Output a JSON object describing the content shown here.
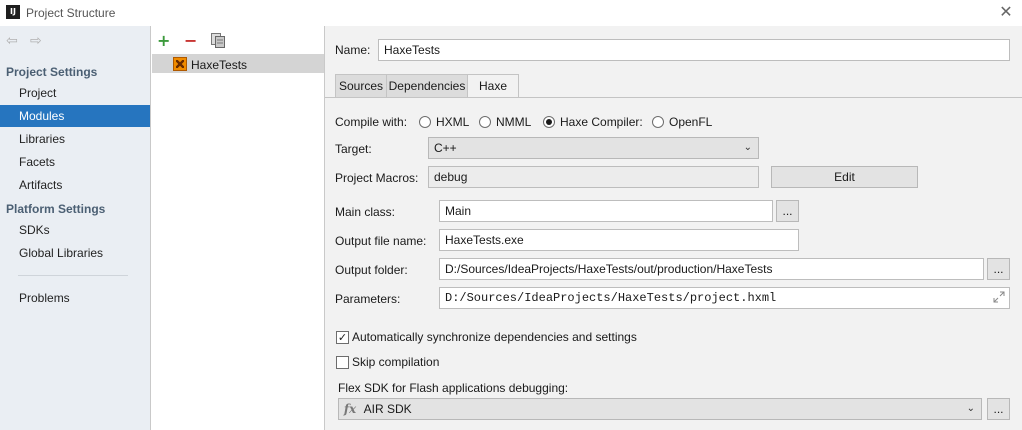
{
  "window": {
    "title": "Project Structure",
    "app_icon": "IJ"
  },
  "nav": {
    "back_icon": "arrow-left-icon",
    "forward_icon": "arrow-right-icon",
    "project_settings_header": "Project Settings",
    "project_settings_items": [
      "Project",
      "Modules",
      "Libraries",
      "Facets",
      "Artifacts"
    ],
    "selected": "Modules",
    "platform_settings_header": "Platform Settings",
    "platform_settings_items": [
      "SDKs",
      "Global Libraries"
    ],
    "problems": "Problems"
  },
  "module_list": {
    "toolbar": {
      "add": "+",
      "remove": "−"
    },
    "modules": [
      "HaxeTests"
    ]
  },
  "module_settings": {
    "name_label": "Name:",
    "name_value": "HaxeTests",
    "tabs": [
      "Sources",
      "Dependencies",
      "Haxe"
    ],
    "active_tab": "Haxe",
    "compile_with_label": "Compile with:",
    "compile_options": [
      "HXML",
      "NMML",
      "Haxe Compiler:",
      "OpenFL"
    ],
    "compile_selected": "Haxe Compiler:",
    "target_label": "Target:",
    "target_value": "C++",
    "macros_label": "Project Macros:",
    "macros_value": "debug",
    "edit_button": "Edit",
    "main_class_label": "Main class:",
    "main_class_value": "Main",
    "browse_label": "...",
    "output_file_label": "Output file name:",
    "output_file_value": "HaxeTests.exe",
    "output_folder_label": "Output folder:",
    "output_folder_value": "D:/Sources/IdeaProjects/HaxeTests/out/production/HaxeTests",
    "parameters_label": "Parameters:",
    "parameters_value": "D:/Sources/IdeaProjects/HaxeTests/project.hxml",
    "auto_sync_label": "Automatically synchronize dependencies and settings",
    "auto_sync_checked": true,
    "skip_compilation_label": "Skip compilation",
    "skip_compilation_checked": false,
    "flex_sdk_label": "Flex SDK for Flash applications debugging:",
    "flex_sdk_value": "AIR SDK"
  },
  "colors": {
    "selection": "#2675bf",
    "section_header": "#4b5f73",
    "add_green": "#3c9a3c",
    "remove_red": "#c7322f"
  }
}
